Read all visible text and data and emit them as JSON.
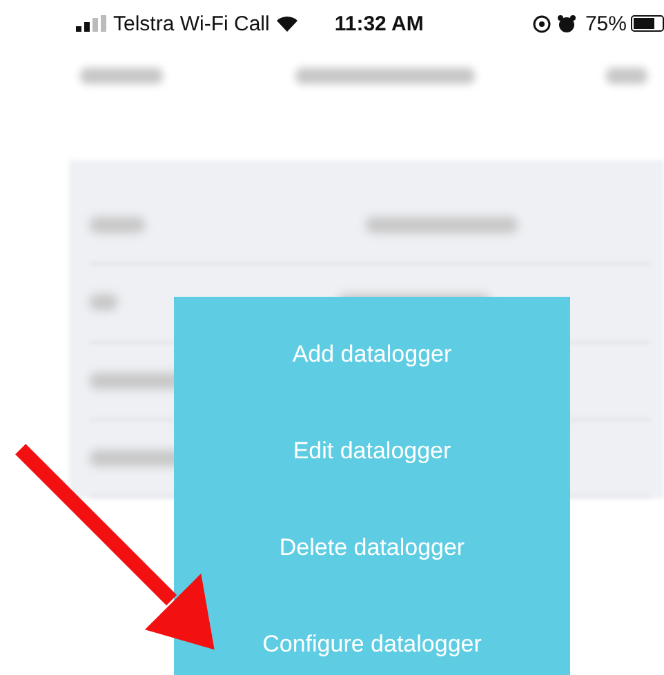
{
  "status_bar": {
    "carrier": "Telstra Wi-Fi Call",
    "time": "11:32 AM",
    "battery": "75%"
  },
  "action_menu": {
    "items": [
      {
        "label": "Add datalogger"
      },
      {
        "label": "Edit datalogger"
      },
      {
        "label": "Delete datalogger"
      },
      {
        "label": "Configure datalogger"
      }
    ]
  }
}
